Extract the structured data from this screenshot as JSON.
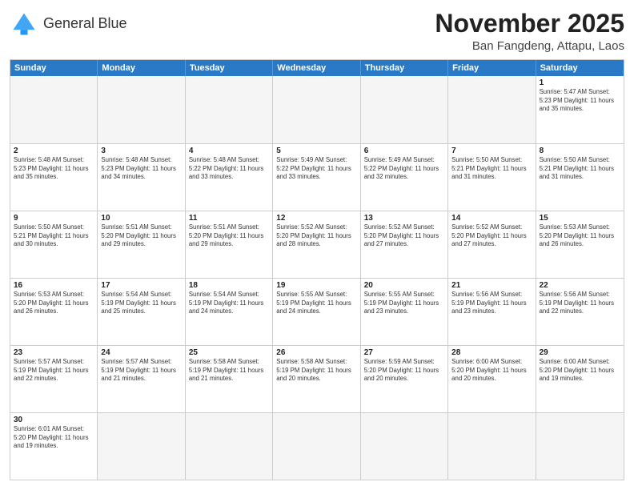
{
  "header": {
    "logo_general": "General",
    "logo_blue": "Blue",
    "month_year": "November 2025",
    "location": "Ban Fangdeng, Attapu, Laos"
  },
  "days_of_week": [
    "Sunday",
    "Monday",
    "Tuesday",
    "Wednesday",
    "Thursday",
    "Friday",
    "Saturday"
  ],
  "weeks": [
    [
      {
        "day": "",
        "info": ""
      },
      {
        "day": "",
        "info": ""
      },
      {
        "day": "",
        "info": ""
      },
      {
        "day": "",
        "info": ""
      },
      {
        "day": "",
        "info": ""
      },
      {
        "day": "",
        "info": ""
      },
      {
        "day": "1",
        "info": "Sunrise: 5:47 AM\nSunset: 5:23 PM\nDaylight: 11 hours and 35 minutes."
      }
    ],
    [
      {
        "day": "2",
        "info": "Sunrise: 5:48 AM\nSunset: 5:23 PM\nDaylight: 11 hours and 35 minutes."
      },
      {
        "day": "3",
        "info": "Sunrise: 5:48 AM\nSunset: 5:23 PM\nDaylight: 11 hours and 34 minutes."
      },
      {
        "day": "4",
        "info": "Sunrise: 5:48 AM\nSunset: 5:22 PM\nDaylight: 11 hours and 33 minutes."
      },
      {
        "day": "5",
        "info": "Sunrise: 5:49 AM\nSunset: 5:22 PM\nDaylight: 11 hours and 33 minutes."
      },
      {
        "day": "6",
        "info": "Sunrise: 5:49 AM\nSunset: 5:22 PM\nDaylight: 11 hours and 32 minutes."
      },
      {
        "day": "7",
        "info": "Sunrise: 5:50 AM\nSunset: 5:21 PM\nDaylight: 11 hours and 31 minutes."
      },
      {
        "day": "8",
        "info": "Sunrise: 5:50 AM\nSunset: 5:21 PM\nDaylight: 11 hours and 31 minutes."
      }
    ],
    [
      {
        "day": "9",
        "info": "Sunrise: 5:50 AM\nSunset: 5:21 PM\nDaylight: 11 hours and 30 minutes."
      },
      {
        "day": "10",
        "info": "Sunrise: 5:51 AM\nSunset: 5:20 PM\nDaylight: 11 hours and 29 minutes."
      },
      {
        "day": "11",
        "info": "Sunrise: 5:51 AM\nSunset: 5:20 PM\nDaylight: 11 hours and 29 minutes."
      },
      {
        "day": "12",
        "info": "Sunrise: 5:52 AM\nSunset: 5:20 PM\nDaylight: 11 hours and 28 minutes."
      },
      {
        "day": "13",
        "info": "Sunrise: 5:52 AM\nSunset: 5:20 PM\nDaylight: 11 hours and 27 minutes."
      },
      {
        "day": "14",
        "info": "Sunrise: 5:52 AM\nSunset: 5:20 PM\nDaylight: 11 hours and 27 minutes."
      },
      {
        "day": "15",
        "info": "Sunrise: 5:53 AM\nSunset: 5:20 PM\nDaylight: 11 hours and 26 minutes."
      }
    ],
    [
      {
        "day": "16",
        "info": "Sunrise: 5:53 AM\nSunset: 5:20 PM\nDaylight: 11 hours and 26 minutes."
      },
      {
        "day": "17",
        "info": "Sunrise: 5:54 AM\nSunset: 5:19 PM\nDaylight: 11 hours and 25 minutes."
      },
      {
        "day": "18",
        "info": "Sunrise: 5:54 AM\nSunset: 5:19 PM\nDaylight: 11 hours and 24 minutes."
      },
      {
        "day": "19",
        "info": "Sunrise: 5:55 AM\nSunset: 5:19 PM\nDaylight: 11 hours and 24 minutes."
      },
      {
        "day": "20",
        "info": "Sunrise: 5:55 AM\nSunset: 5:19 PM\nDaylight: 11 hours and 23 minutes."
      },
      {
        "day": "21",
        "info": "Sunrise: 5:56 AM\nSunset: 5:19 PM\nDaylight: 11 hours and 23 minutes."
      },
      {
        "day": "22",
        "info": "Sunrise: 5:56 AM\nSunset: 5:19 PM\nDaylight: 11 hours and 22 minutes."
      }
    ],
    [
      {
        "day": "23",
        "info": "Sunrise: 5:57 AM\nSunset: 5:19 PM\nDaylight: 11 hours and 22 minutes."
      },
      {
        "day": "24",
        "info": "Sunrise: 5:57 AM\nSunset: 5:19 PM\nDaylight: 11 hours and 21 minutes."
      },
      {
        "day": "25",
        "info": "Sunrise: 5:58 AM\nSunset: 5:19 PM\nDaylight: 11 hours and 21 minutes."
      },
      {
        "day": "26",
        "info": "Sunrise: 5:58 AM\nSunset: 5:19 PM\nDaylight: 11 hours and 20 minutes."
      },
      {
        "day": "27",
        "info": "Sunrise: 5:59 AM\nSunset: 5:20 PM\nDaylight: 11 hours and 20 minutes."
      },
      {
        "day": "28",
        "info": "Sunrise: 6:00 AM\nSunset: 5:20 PM\nDaylight: 11 hours and 20 minutes."
      },
      {
        "day": "29",
        "info": "Sunrise: 6:00 AM\nSunset: 5:20 PM\nDaylight: 11 hours and 19 minutes."
      }
    ],
    [
      {
        "day": "30",
        "info": "Sunrise: 6:01 AM\nSunset: 5:20 PM\nDaylight: 11 hours and 19 minutes."
      },
      {
        "day": "",
        "info": ""
      },
      {
        "day": "",
        "info": ""
      },
      {
        "day": "",
        "info": ""
      },
      {
        "day": "",
        "info": ""
      },
      {
        "day": "",
        "info": ""
      },
      {
        "day": "",
        "info": ""
      }
    ]
  ]
}
